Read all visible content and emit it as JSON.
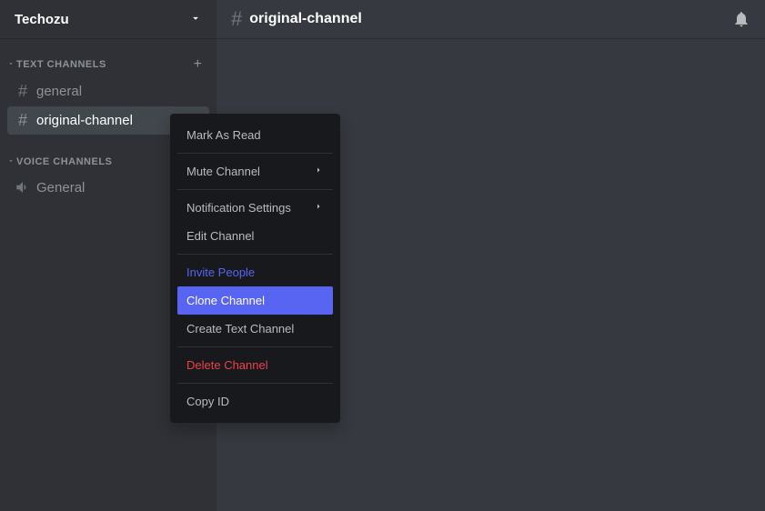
{
  "server": {
    "name": "Techozu"
  },
  "sections": {
    "text": {
      "title": "TEXT CHANNELS",
      "channels": [
        "general",
        "original-channel"
      ]
    },
    "voice": {
      "title": "VOICE CHANNELS",
      "channels": [
        "General"
      ]
    }
  },
  "header": {
    "channel": "original-channel"
  },
  "contextMenu": {
    "markAsRead": "Mark As Read",
    "muteChannel": "Mute Channel",
    "notificationSettings": "Notification Settings",
    "editChannel": "Edit Channel",
    "invitePeople": "Invite People",
    "cloneChannel": "Clone Channel",
    "createTextChannel": "Create Text Channel",
    "deleteChannel": "Delete Channel",
    "copyId": "Copy ID"
  }
}
